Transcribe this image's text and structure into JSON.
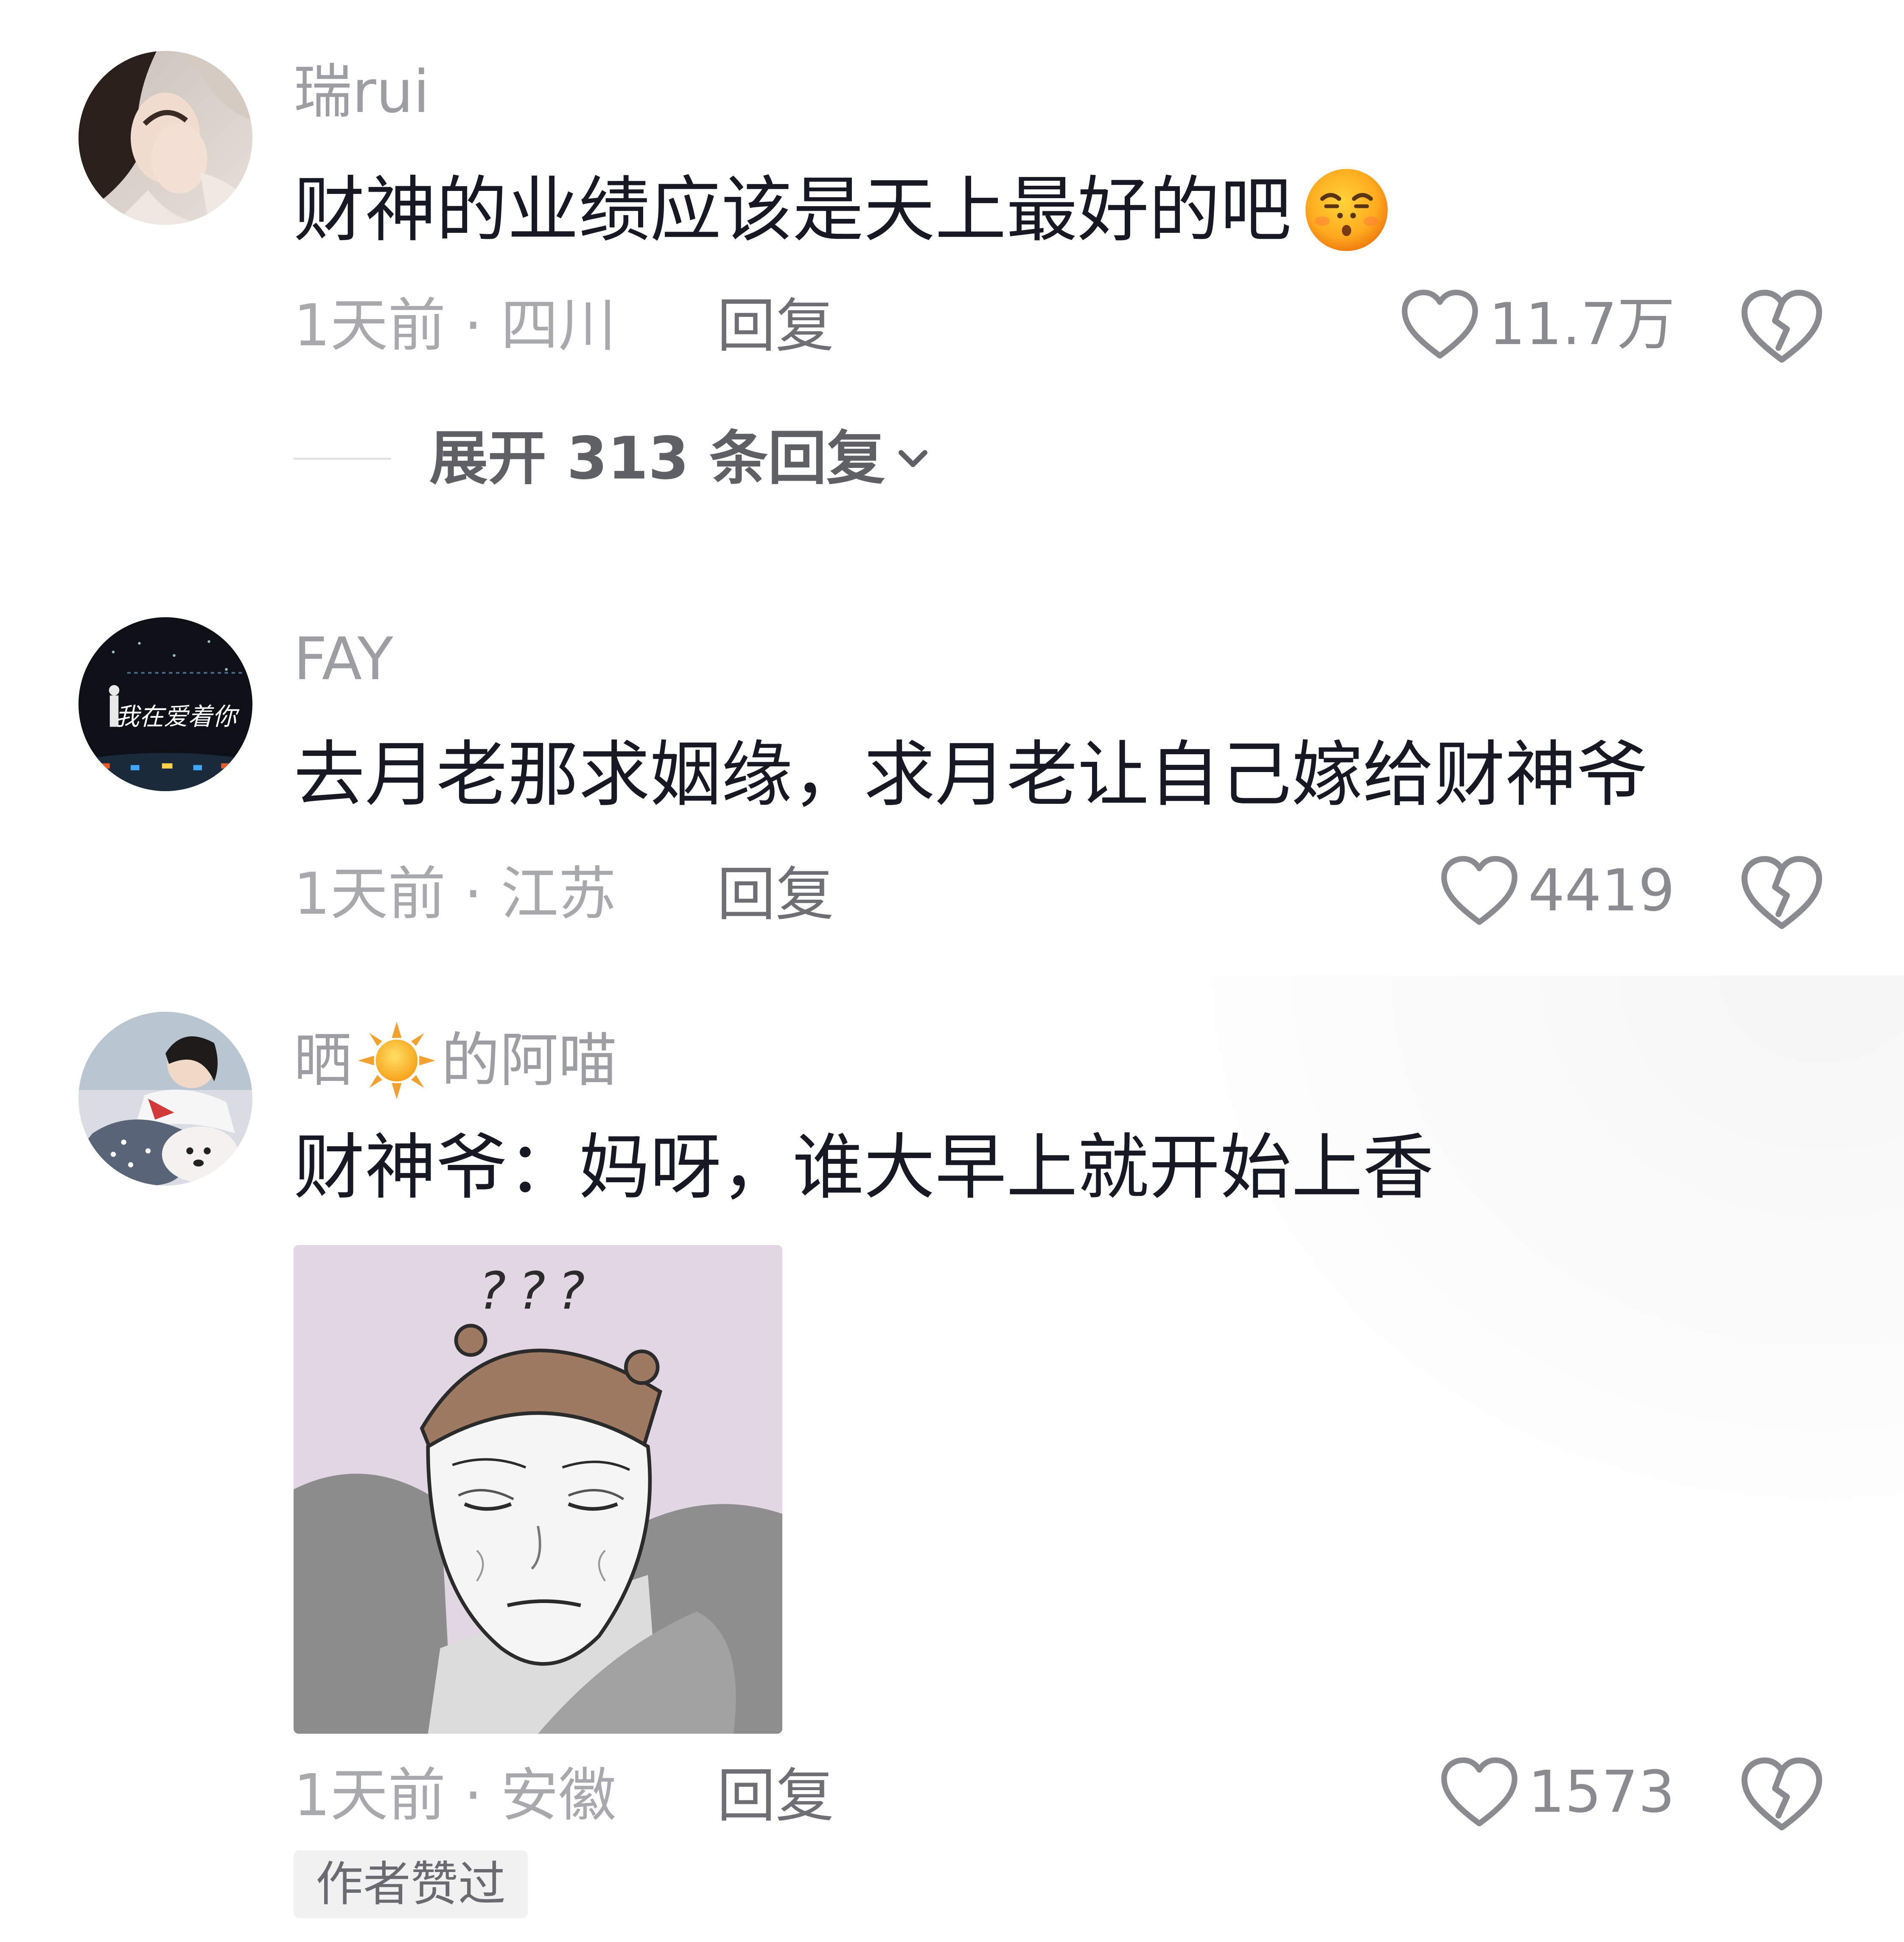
{
  "comments": [
    {
      "username": "瑞rui",
      "text": "财神的业绩应该是天上最好的吧",
      "emoji": "smirk-face-emoji",
      "time_location": "1天前 · 四川",
      "reply_label": "回复",
      "likes": "11.7万",
      "expand_label": "展开 313 条回复"
    },
    {
      "username": "FAY",
      "avatar_caption": "我在爱着你",
      "text": "去月老那求姻缘，求月老让自己嫁给财神爷",
      "time_location": "1天前 · 江苏",
      "reply_label": "回复",
      "likes": "4419"
    },
    {
      "username_prefix": "晒",
      "username_icon": "sun-emoji",
      "username_suffix": "的阿喵",
      "text": "财神爷：妈呀，谁大早上就开始上香",
      "sticker_text": "???",
      "time_location": "1天前 · 安徽",
      "reply_label": "回复",
      "likes": "1573",
      "badge": "作者赞过"
    }
  ],
  "icons": {
    "like": "heart-outline-icon",
    "dislike": "broken-heart-icon",
    "expand": "chevron-down-icon"
  },
  "colors": {
    "text_primary": "#161823",
    "text_secondary": "#9d9ea3",
    "sticker_bg": "#e2d6e4"
  }
}
